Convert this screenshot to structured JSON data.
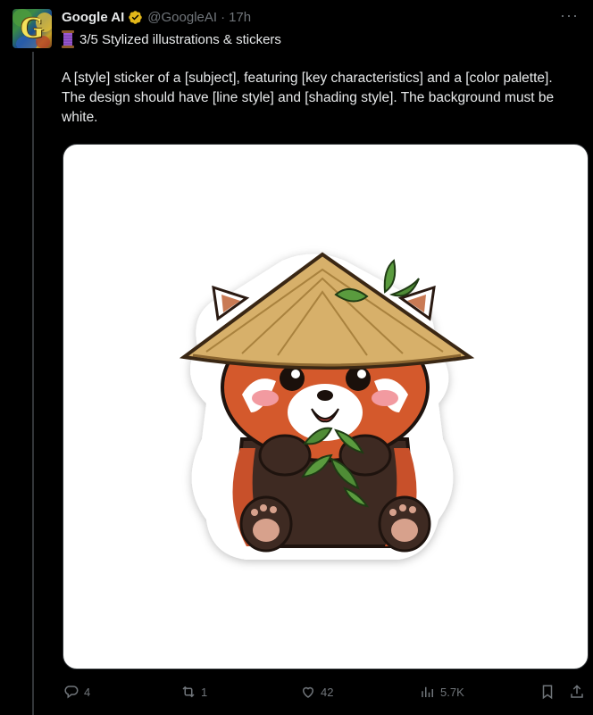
{
  "post": {
    "author": {
      "display_name": "Google AI",
      "handle": "@GoogleAI",
      "separator": "·",
      "timestamp": "17h",
      "avatar_letter": "G",
      "verified": true,
      "verified_color": "#e2b719"
    },
    "subtitle": "3/5 Stylized illustrations & stickers",
    "thread_emoji": "thread-spool-icon",
    "body": "A [style] sticker of a [subject], featuring [key characteristics] and a [color palette]. The design should have [line style] and [shading style]. The background must be white.",
    "more_icon": "more-horizontal-icon",
    "media": {
      "description_icon": "red-panda-sticker-image"
    },
    "actions": {
      "replies": "4",
      "reposts": "1",
      "likes": "42",
      "views": "5.7K"
    }
  },
  "colors": {
    "background": "#000000",
    "text": "#e7e9ea",
    "muted": "#71767b",
    "divider": "#333639"
  }
}
